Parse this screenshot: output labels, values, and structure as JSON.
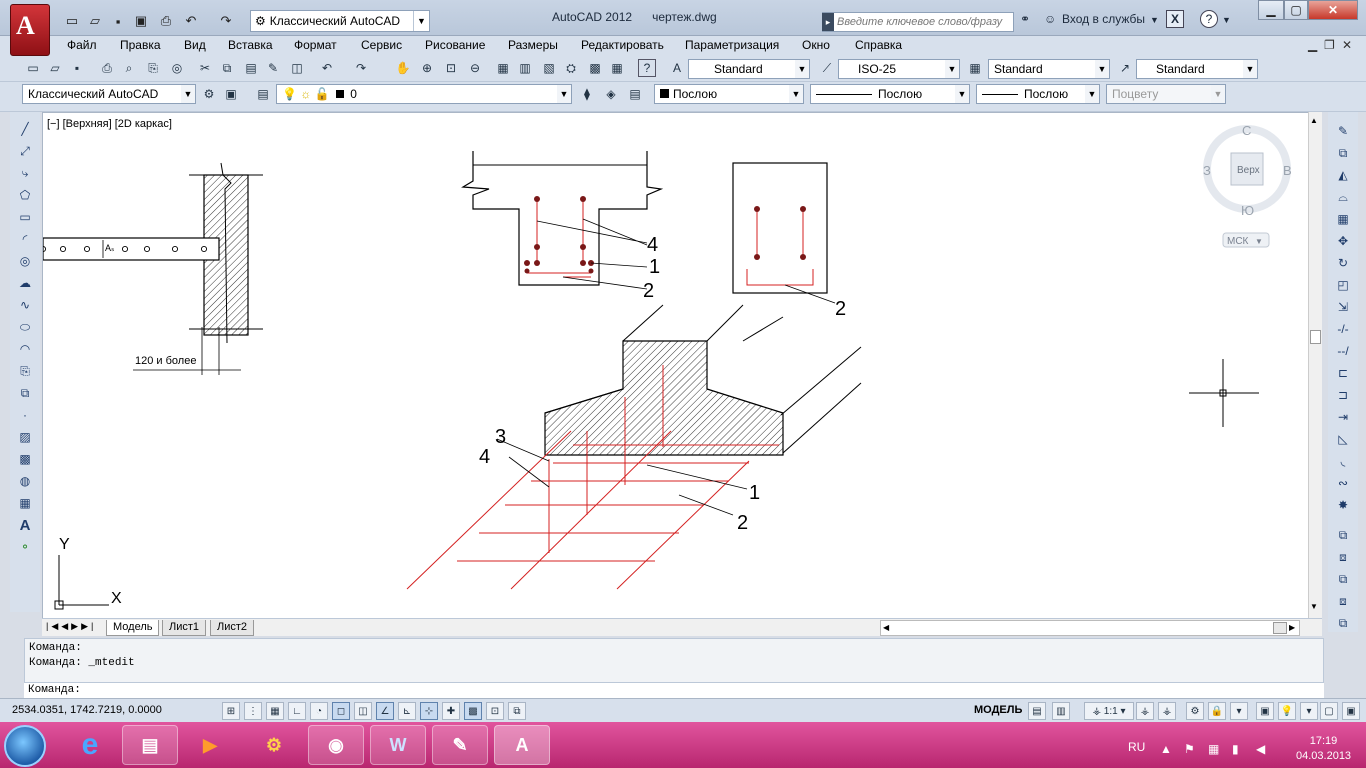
{
  "window": {
    "title": "AutoCAD 2012",
    "file_name": "чертеж.dwg",
    "workspace": "Классический AutoCAD",
    "search_placeholder": "Введите ключевое слово/фразу",
    "login": "Вход в службы",
    "help": "?"
  },
  "menu": [
    "Файл",
    "Правка",
    "Вид",
    "Вставка",
    "Формат",
    "Сервис",
    "Рисование",
    "Размеры",
    "Редактировать",
    "Параметризация",
    "Окно",
    "Справка"
  ],
  "styles": {
    "text_style": "Standard",
    "dim_style": "ISO-25",
    "table_style": "Standard",
    "mleader_style": "Standard"
  },
  "layers": {
    "workspace": "Классический AutoCAD",
    "layer_name": "0",
    "color": "Послою",
    "linetype": "Послою",
    "lineweight": "Послою",
    "plotstyle": "Поцвету"
  },
  "viewport": {
    "label": "[−] [Верхняя] [2D каркас]"
  },
  "viewcube": {
    "north": "С",
    "south": "Ю",
    "west": "З",
    "east": "В",
    "face": "Верх",
    "ucs": "МСК"
  },
  "drawing_labels": {
    "wall_note": "120 и более",
    "as_label": "Aₛ",
    "beam_4": "4",
    "beam_1": "1",
    "beam_2": "2",
    "col_2": "2",
    "f_3": "3",
    "f_4": "4",
    "f_1": "1",
    "f_2": "2",
    "ucs_y": "Y",
    "ucs_x": "X"
  },
  "tabs": [
    "Модель",
    "Лист1",
    "Лист2"
  ],
  "command": {
    "line1": "Команда:",
    "line2": "Команда:  _mtedit",
    "prompt": "Команда:"
  },
  "status": {
    "coords": "2534.0351, 1742.7219, 0.0000",
    "space": "МОДЕЛЬ",
    "scale": "1:1"
  },
  "taskbar": {
    "lang": "RU",
    "time": "17:19",
    "date": "04.03.2013"
  },
  "colors": {
    "rebar": "#d42020",
    "accent": "#c4317a"
  }
}
